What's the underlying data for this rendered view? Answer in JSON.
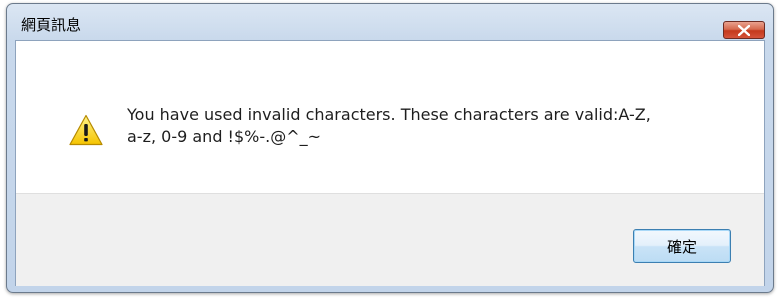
{
  "window": {
    "title": "網頁訊息",
    "close_icon": "close-icon"
  },
  "dialog": {
    "icon": "warning-icon",
    "message": "You have used invalid characters. These characters are valid:A-Z,\na-z, 0-9 and !$%-.@^_~",
    "ok_label": "確定"
  },
  "colors": {
    "close_button": "#c4391c",
    "warning_fill": "#f5c400",
    "ok_border": "#3c7fb1"
  }
}
